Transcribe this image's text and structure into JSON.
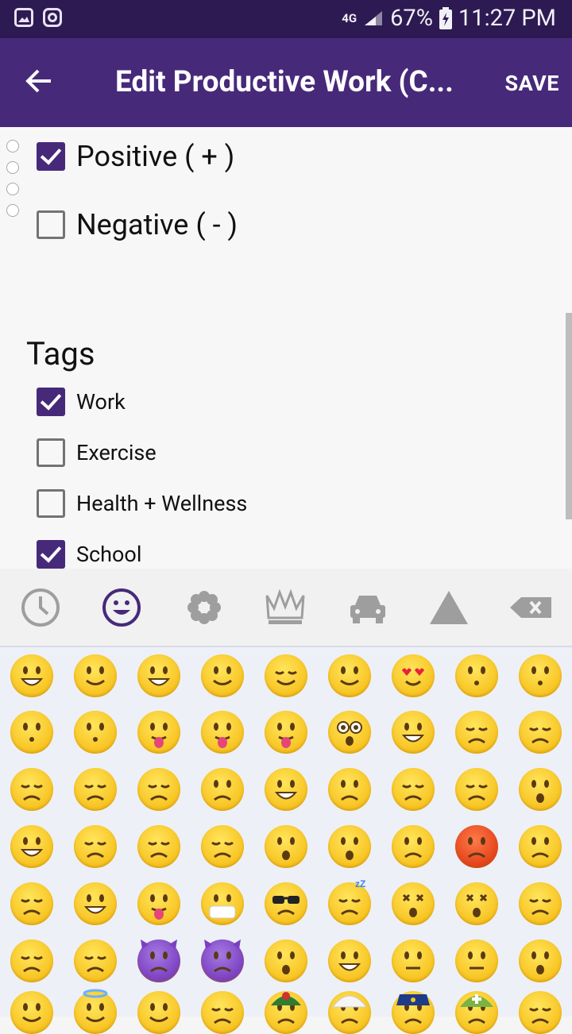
{
  "status_bar": {
    "network": "4G",
    "battery": "67%",
    "time": "11:27 PM"
  },
  "app_bar": {
    "title": "Edit Productive Work (C...",
    "save_label": "SAVE"
  },
  "valence": [
    {
      "label": "Positive ( + )",
      "checked": true
    },
    {
      "label": "Negative ( - )",
      "checked": false
    }
  ],
  "tags": {
    "heading": "Tags",
    "items": [
      {
        "label": "Work",
        "checked": true
      },
      {
        "label": "Exercise",
        "checked": false
      },
      {
        "label": "Health + Wellness",
        "checked": false
      },
      {
        "label": "School",
        "checked": true
      }
    ]
  },
  "keyboard": {
    "tabs": [
      "clock-icon",
      "smiley-icon",
      "flower-icon",
      "crown-icon",
      "car-icon",
      "triangle-icon",
      "backspace-icon"
    ],
    "active_tab": "smiley-icon",
    "accent": "#47297a"
  }
}
